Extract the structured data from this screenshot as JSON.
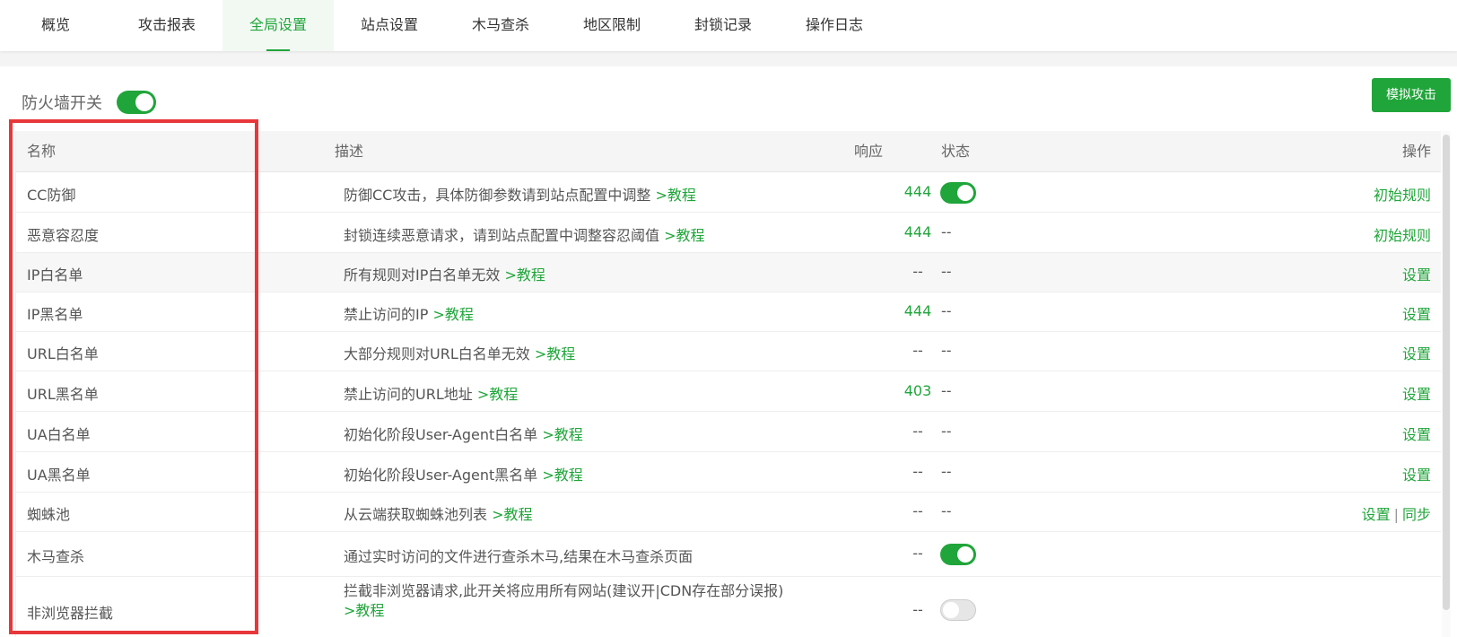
{
  "tabs": [
    {
      "label": "概览"
    },
    {
      "label": "攻击报表"
    },
    {
      "label": "全局设置",
      "active": true
    },
    {
      "label": "站点设置"
    },
    {
      "label": "木马查杀"
    },
    {
      "label": "地区限制"
    },
    {
      "label": "封锁记录"
    },
    {
      "label": "操作日志"
    }
  ],
  "firewall": {
    "label": "防火墙开关",
    "enabled": true
  },
  "simulate_button": "模拟攻击",
  "table": {
    "headers": {
      "name": "名称",
      "desc": "描述",
      "response": "响应",
      "status": "状态",
      "action": "操作"
    },
    "rows": [
      {
        "name": "CC防御",
        "desc": "防御CC攻击，具体防御参数请到站点配置中调整",
        "link": ">教程",
        "response": "444",
        "status": "on",
        "actions": [
          "初始规则"
        ]
      },
      {
        "name": "恶意容忍度",
        "desc": "封锁连续恶意请求，请到站点配置中调整容忍阈值",
        "link": ">教程",
        "response": "444",
        "status": "--",
        "actions": [
          "初始规则"
        ]
      },
      {
        "name": "IP白名单",
        "desc": "所有规则对IP白名单无效",
        "link": ">教程",
        "response": "--",
        "status": "--",
        "actions": [
          "设置"
        ]
      },
      {
        "name": "IP黑名单",
        "desc": "禁止访问的IP",
        "link": ">教程",
        "response": "444",
        "status": "--",
        "actions": [
          "设置"
        ]
      },
      {
        "name": "URL白名单",
        "desc": "大部分规则对URL白名单无效",
        "link": ">教程",
        "response": "--",
        "status": "--",
        "actions": [
          "设置"
        ]
      },
      {
        "name": "URL黑名单",
        "desc": "禁止访问的URL地址",
        "link": ">教程",
        "response": "403",
        "status": "--",
        "actions": [
          "设置"
        ]
      },
      {
        "name": "UA白名单",
        "desc": "初始化阶段User-Agent白名单",
        "link": ">教程",
        "response": "--",
        "status": "--",
        "actions": [
          "设置"
        ]
      },
      {
        "name": "UA黑名单",
        "desc": "初始化阶段User-Agent黑名单",
        "link": ">教程",
        "response": "--",
        "status": "--",
        "actions": [
          "设置"
        ]
      },
      {
        "name": "蜘蛛池",
        "desc": "从云端获取蜘蛛池列表",
        "link": ">教程",
        "response": "--",
        "status": "--",
        "actions": [
          "设置",
          "同步"
        ]
      },
      {
        "name": "木马查杀",
        "desc": "通过实时访问的文件进行查杀木马,结果在木马查杀页面",
        "link": "",
        "response": "--",
        "status": "on",
        "actions": []
      },
      {
        "name": "非浏览器拦截",
        "desc": "拦截非浏览器请求,此开关将应用所有网站(建议开|CDN存在部分误报)",
        "link": ">教程",
        "response": "--",
        "status": "off",
        "actions": []
      }
    ]
  },
  "colors": {
    "accent": "#20a53a",
    "highlight_box": "#e8373a"
  }
}
